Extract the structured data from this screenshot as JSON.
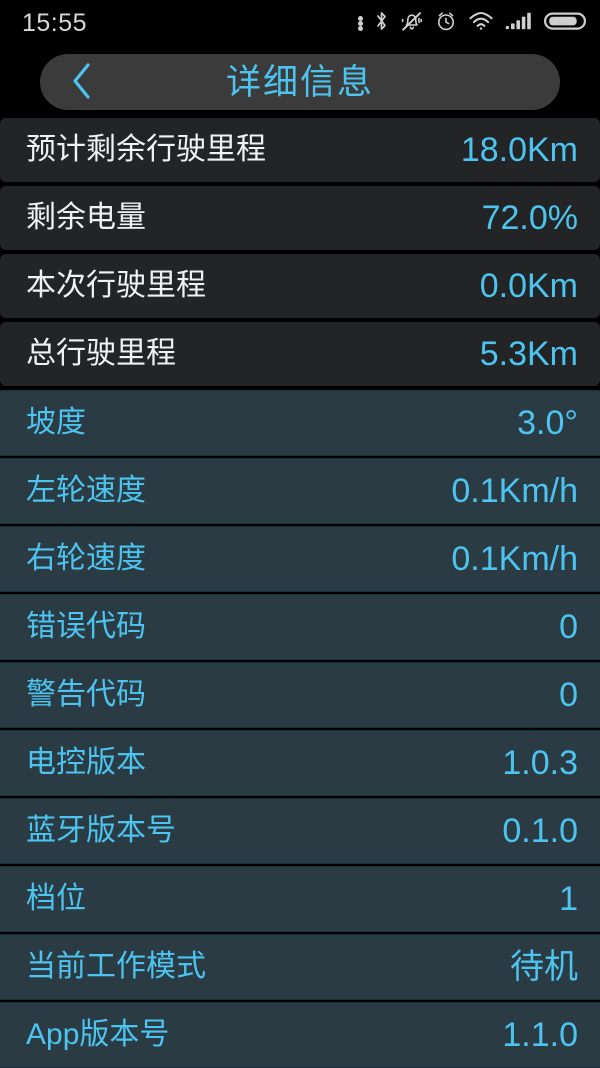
{
  "statusbar": {
    "time": "15:55",
    "icons": [
      {
        "name": "more-dots-icon"
      },
      {
        "name": "bluetooth-icon"
      },
      {
        "name": "mute-bell-icon"
      },
      {
        "name": "alarm-clock-icon"
      },
      {
        "name": "wifi-icon"
      },
      {
        "name": "signal-bars-icon"
      },
      {
        "name": "battery-icon"
      }
    ]
  },
  "titlebar": {
    "back_label": "‹",
    "title": "详细信息"
  },
  "colors": {
    "accent": "#4cc4ef",
    "row_grey": "#232426",
    "row_blue": "#2b3b44",
    "background": "#000000",
    "titlebar": "#3b3b3b",
    "label_white": "#f2f2f2"
  },
  "list": {
    "rows": [
      {
        "label": "预计剩余行驶里程",
        "value": "18.0Km",
        "theme": "theme-dark-grey"
      },
      {
        "label": "剩余电量",
        "value": "72.0%",
        "theme": "theme-dark-grey"
      },
      {
        "label": "本次行驶里程",
        "value": "0.0Km",
        "theme": "theme-dark-grey"
      },
      {
        "label": "总行驶里程",
        "value": "5.3Km",
        "theme": "theme-dark-grey"
      },
      {
        "label": "坡度",
        "value": "3.0°",
        "theme": "theme-blue"
      },
      {
        "label": "左轮速度",
        "value": "0.1Km/h",
        "theme": "theme-blue"
      },
      {
        "label": "右轮速度",
        "value": "0.1Km/h",
        "theme": "theme-blue"
      },
      {
        "label": "错误代码",
        "value": "0",
        "theme": "theme-blue"
      },
      {
        "label": "警告代码",
        "value": "0",
        "theme": "theme-blue"
      },
      {
        "label": "电控版本",
        "value": "1.0.3",
        "theme": "theme-blue"
      },
      {
        "label": "蓝牙版本号",
        "value": "0.1.0",
        "theme": "theme-blue"
      },
      {
        "label": "档位",
        "value": "1",
        "theme": "theme-blue"
      },
      {
        "label": "当前工作模式",
        "value": "待机",
        "theme": "theme-blue"
      },
      {
        "label": "App版本号",
        "value": "1.1.0",
        "theme": "theme-blue"
      }
    ]
  }
}
